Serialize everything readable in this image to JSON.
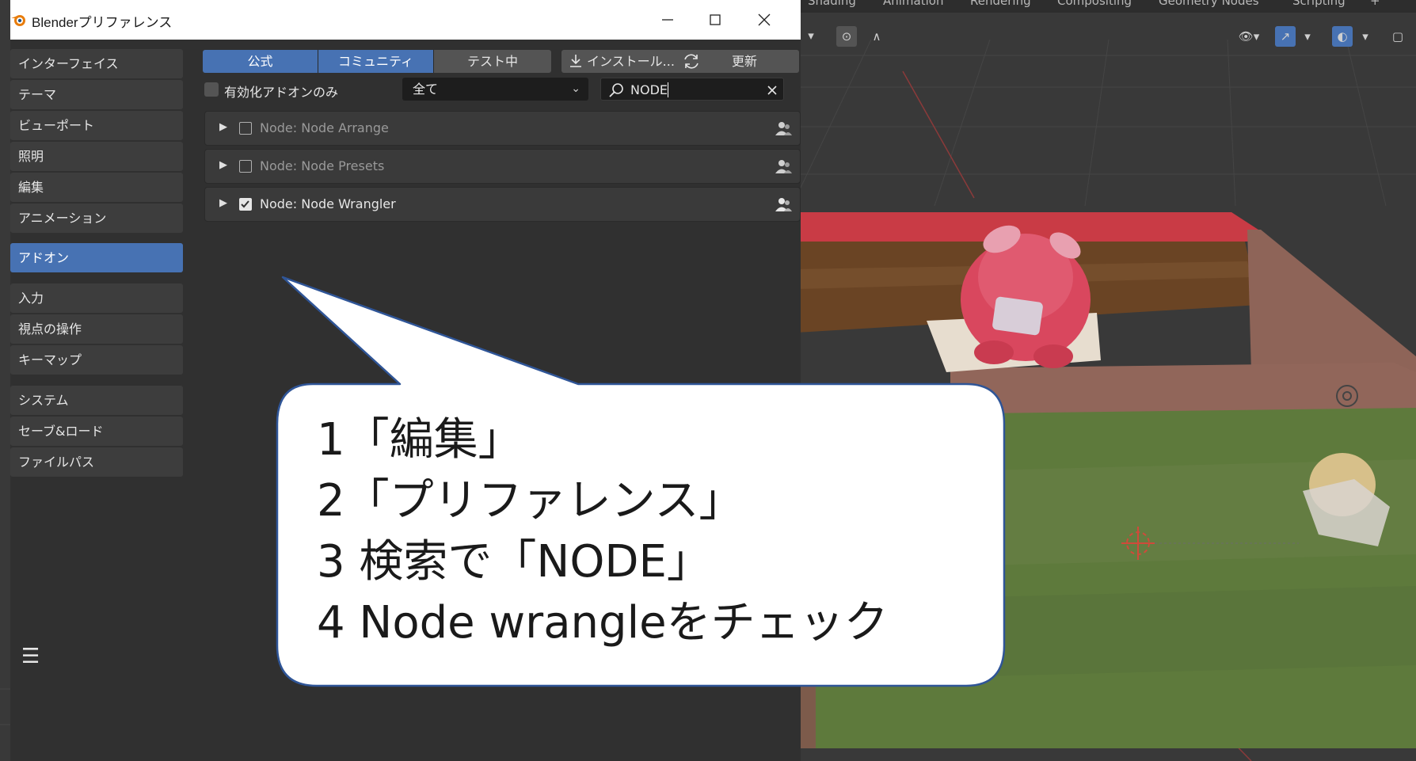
{
  "window": {
    "title": "Blenderプリファレンス"
  },
  "viewport": {
    "workspace_tabs": [
      "Shading",
      "Animation",
      "Rendering",
      "Compositing",
      "Geometry Nodes",
      "Scripting",
      "+"
    ]
  },
  "sidebar": {
    "items": [
      {
        "label": "インターフェイス"
      },
      {
        "label": "テーマ"
      },
      {
        "label": "ビューポート"
      },
      {
        "label": "照明"
      },
      {
        "label": "編集"
      },
      {
        "label": "アニメーション"
      },
      {
        "label": "アドオン",
        "active": true
      },
      {
        "label": "入力"
      },
      {
        "label": "視点の操作"
      },
      {
        "label": "キーマップ"
      },
      {
        "label": "システム"
      },
      {
        "label": "セーブ&ロード"
      },
      {
        "label": "ファイルパス"
      }
    ]
  },
  "addons": {
    "tabs": [
      {
        "label": "公式",
        "active": true
      },
      {
        "label": "コミュニティ",
        "active": true
      },
      {
        "label": "テスト中",
        "active": false
      }
    ],
    "install_label": "インストール...",
    "refresh_label": "更新",
    "enabled_only_label": "有効化アドオンのみ",
    "category_value": "全て",
    "search_value": "NODE",
    "rows": [
      {
        "name": "Node: Node Arrange",
        "enabled": false
      },
      {
        "name": "Node: Node Presets",
        "enabled": false
      },
      {
        "name": "Node: Node Wrangler",
        "enabled": true
      }
    ]
  },
  "callout": {
    "lines": [
      "1「編集」",
      "2「プリファレンス」",
      "3 検索で「NODE」",
      "4 Node wrangleをチェック"
    ]
  },
  "colors": {
    "accent": "#4772b3",
    "panel": "#303030",
    "callout_border": "#2f5597"
  }
}
